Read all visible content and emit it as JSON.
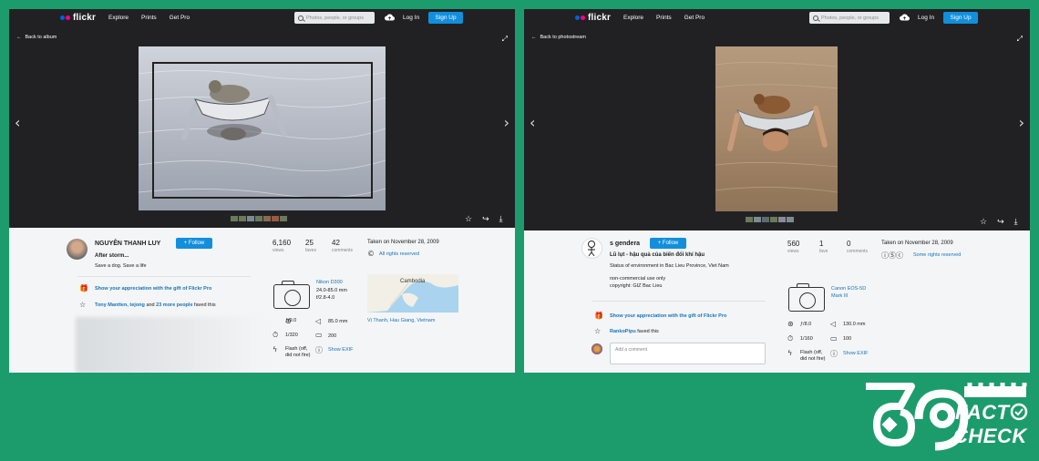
{
  "left": {
    "nav": {
      "logo": "flickr",
      "links": [
        "Explore",
        "Prints",
        "Get Pro"
      ],
      "search_placeholder": "Photos, people, or groups",
      "login": "Log In",
      "signup": "Sign Up"
    },
    "back": "Back to album",
    "author": "NGUYÊN THANH LUY",
    "follow": "+ Follow",
    "title": "After storm...",
    "description": "Save a dog. Save a life",
    "stats": {
      "views": "6,160",
      "views_label": "views",
      "faves": "25",
      "faves_label": "faves",
      "comments": "42",
      "comments_label": "comments"
    },
    "taken": "Taken on November 28, 2009",
    "license": "All rights reserved",
    "appreciation": "Show your appreciation with the gift of Flickr Pro",
    "faved_names": "Tony Mantten, tejong",
    "faved_and": "and",
    "faved_more": "23 more people",
    "faved_tail": "faved this",
    "camera": {
      "model": "Nikon D300",
      "lens": "24.0-85.0 mm",
      "aperture_range": "f/2.8-4.0"
    },
    "exif": {
      "fstop": "ƒ/9.0",
      "focal": "85.0 mm",
      "shutter": "1/320",
      "iso": "200",
      "flash": "Flash (off, did not fire)",
      "show": "Show EXIF"
    },
    "map_label": "Cambodia",
    "location": "Vị Thanh, Hau Giang, Vietnam"
  },
  "right": {
    "nav": {
      "logo": "flickr",
      "links": [
        "Explore",
        "Prints",
        "Get Pro"
      ],
      "search_placeholder": "Photos, people, or groups",
      "login": "Log In",
      "signup": "Sign Up"
    },
    "back": "Back to photostream",
    "author": "s gendera",
    "follow": "+ Follow",
    "title": "Lũ lụt - hậu quả của biến đổi khí hậu",
    "description": "Status of environment in Bac Lieu Province, Viet Nam",
    "note1": "non-commercial use only",
    "note2": "copyright: GIZ Bac Lieu",
    "stats": {
      "views": "560",
      "views_label": "views",
      "faves": "1",
      "faves_label": "fave",
      "comments": "0",
      "comments_label": "comments"
    },
    "taken": "Taken on November 28, 2009",
    "license": "Some rights reserved",
    "appreciation": "Show your appreciation with the gift of Flickr Pro",
    "faved_names": "RankoPipu",
    "faved_tail": "faved this",
    "comment_placeholder": "Add a comment",
    "camera": {
      "model": "Canon EOS-5D",
      "lens": "Mark III"
    },
    "exif": {
      "fstop": "ƒ/8.0",
      "focal": "130.0 mm",
      "shutter": "1/160",
      "iso": "100",
      "flash": "Flash (off, did not fire)",
      "show": "Show EXIF"
    }
  },
  "brand": {
    "number": "69",
    "line1": "FACT",
    "line2": "CHECK"
  },
  "colors": {
    "background": "#1c9c6c",
    "flickr_blue": "#0063dc",
    "flickr_pink": "#ff0084",
    "button_blue": "#128fdc"
  }
}
